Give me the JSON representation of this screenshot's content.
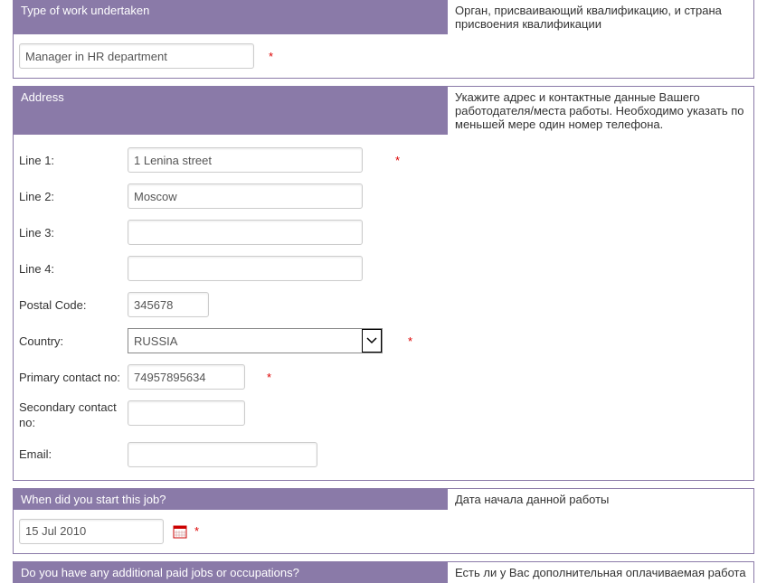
{
  "work_type": {
    "header": "Type of work undertaken",
    "value": "Manager in HR department",
    "help": "Орган, присваивающий квалификацию, и страна присвоения квалификации"
  },
  "address": {
    "header": "Address",
    "help": "Укажите адрес и контактные данные Вашего работодателя/места работы. Необходимо указать по меньшей мере один номер телефона.",
    "line1_label": "Line 1:",
    "line1_value": "1 Lenina street",
    "line2_label": "Line 2:",
    "line2_value": "Moscow",
    "line3_label": "Line 3:",
    "line3_value": "",
    "line4_label": "Line 4:",
    "line4_value": "",
    "postal_label": "Postal Code:",
    "postal_value": "345678",
    "country_label": "Country:",
    "country_value": "RUSSIA",
    "primary_label": "Primary contact no:",
    "primary_value": "74957895634",
    "secondary_label": "Secondary contact no:",
    "secondary_value": "",
    "email_label": "Email:",
    "email_value": ""
  },
  "start_job": {
    "header": "When did you start this job?",
    "help": "Дата начала данной работы",
    "value": "15 Jul 2010"
  },
  "additional_jobs": {
    "header": "Do you have any additional paid jobs or occupations?",
    "help": "Есть ли у Вас дополнительная оплачиваемая работа"
  }
}
